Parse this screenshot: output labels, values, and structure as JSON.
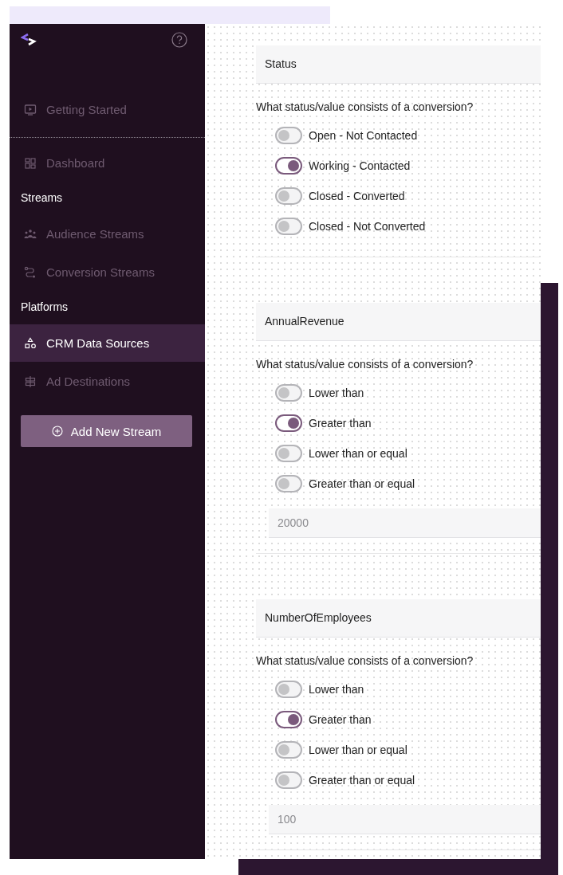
{
  "sidebar": {
    "groups": [
      {
        "items": [
          {
            "label": "Getting Started",
            "selected": false
          }
        ]
      },
      {
        "items": [
          {
            "label": "Dashboard",
            "selected": false
          }
        ]
      },
      {
        "heading": "Streams",
        "items": [
          {
            "label": "Audience Streams",
            "selected": false
          },
          {
            "label": "Conversion Streams",
            "selected": false
          }
        ]
      },
      {
        "heading": "Platforms",
        "items": [
          {
            "label": "CRM Data Sources",
            "selected": true
          },
          {
            "label": "Ad Destinations",
            "selected": false
          }
        ]
      }
    ],
    "button": "Add New Stream"
  },
  "sections": [
    {
      "field": "Status",
      "question": "What status/value consists of a conversion?",
      "options": [
        {
          "label": "Open - Not Contacted",
          "selected": false
        },
        {
          "label": "Working - Contacted",
          "selected": true
        },
        {
          "label": "Closed - Converted",
          "selected": false
        },
        {
          "label": "Closed - Not Converted",
          "selected": false
        }
      ]
    },
    {
      "field": "AnnualRevenue",
      "question": "What status/value consists of a conversion?",
      "options": [
        {
          "label": "Lower than",
          "selected": false
        },
        {
          "label": "Greater than",
          "selected": true
        },
        {
          "label": "Lower than or equal",
          "selected": false
        },
        {
          "label": "Greater than or equal",
          "selected": false
        }
      ],
      "input": {
        "placeholder": "20000"
      }
    },
    {
      "field": "NumberOfEmployees",
      "question": "What status/value consists of a conversion?",
      "options": [
        {
          "label": "Lower than",
          "selected": false
        },
        {
          "label": "Greater than",
          "selected": true
        },
        {
          "label": "Lower than or equal",
          "selected": false
        },
        {
          "label": "Greater than or equal",
          "selected": false
        }
      ],
      "input": {
        "placeholder": "100"
      }
    }
  ]
}
